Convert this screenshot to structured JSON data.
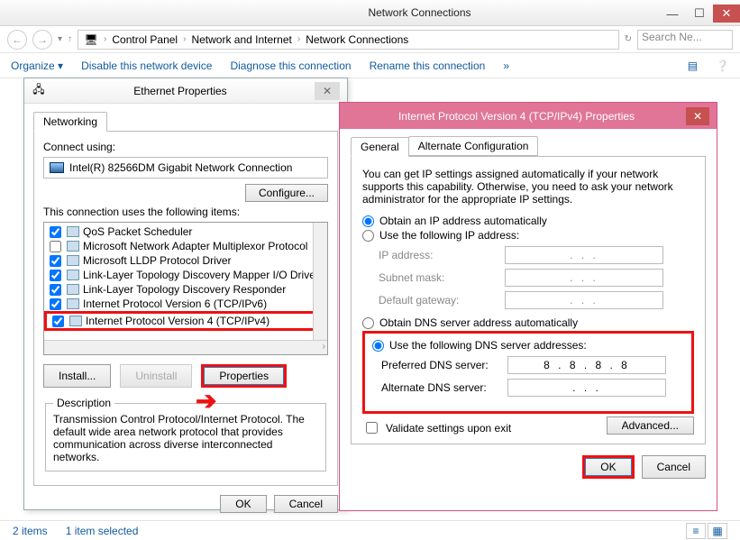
{
  "explorer": {
    "title": "Network Connections",
    "path": [
      "Control Panel",
      "Network and Internet",
      "Network Connections"
    ],
    "search_placeholder": "Search Ne...",
    "commands": {
      "organize": "Organize ▾",
      "disable": "Disable this network device",
      "diagnose": "Diagnose this connection",
      "rename": "Rename this connection",
      "more": "»"
    },
    "status": {
      "items": "2 items",
      "selected": "1 item selected"
    }
  },
  "eth": {
    "title": "Ethernet Properties",
    "tab": "Networking",
    "connect_label": "Connect using:",
    "adapter": "Intel(R) 82566DM Gigabit Network Connection",
    "configure": "Configure...",
    "items_label": "This connection uses the following items:",
    "items": [
      {
        "checked": true,
        "label": "QoS Packet Scheduler"
      },
      {
        "checked": false,
        "label": "Microsoft Network Adapter Multiplexor Protocol"
      },
      {
        "checked": true,
        "label": "Microsoft LLDP Protocol Driver"
      },
      {
        "checked": true,
        "label": "Link-Layer Topology Discovery Mapper I/O Driver"
      },
      {
        "checked": true,
        "label": "Link-Layer Topology Discovery Responder"
      },
      {
        "checked": true,
        "label": "Internet Protocol Version 6 (TCP/IPv6)"
      },
      {
        "checked": true,
        "label": "Internet Protocol Version 4 (TCP/IPv4)"
      }
    ],
    "install": "Install...",
    "uninstall": "Uninstall",
    "properties": "Properties",
    "desc_label": "Description",
    "desc_text": "Transmission Control Protocol/Internet Protocol. The default wide area network protocol that provides communication across diverse interconnected networks.",
    "ok": "OK",
    "cancel": "Cancel"
  },
  "ip": {
    "title": "Internet Protocol Version 4 (TCP/IPv4) Properties",
    "tabs": {
      "general": "General",
      "alt": "Alternate Configuration"
    },
    "intro": "You can get IP settings assigned automatically if your network supports this capability. Otherwise, you need to ask your network administrator for the appropriate IP settings.",
    "r_auto_ip": "Obtain an IP address automatically",
    "r_manual_ip": "Use the following IP address:",
    "f_ip": "IP address:",
    "f_mask": "Subnet mask:",
    "f_gw": "Default gateway:",
    "r_auto_dns": "Obtain DNS server address automatically",
    "r_manual_dns": "Use the following DNS server addresses:",
    "f_pdns": "Preferred DNS server:",
    "f_adns": "Alternate DNS server:",
    "pdns_value": "8 . 8 . 8 . 8",
    "adns_value": " .   .   . ",
    "blank_ip": " .   .   . ",
    "validate": "Validate settings upon exit",
    "advanced": "Advanced...",
    "ok": "OK",
    "cancel": "Cancel"
  }
}
